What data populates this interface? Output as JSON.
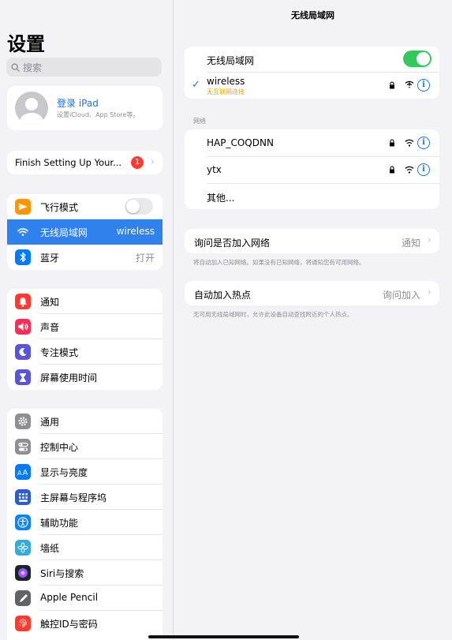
{
  "sidebar": {
    "title": "设置",
    "search_placeholder": "搜索",
    "profile": {
      "title": "登录 iPad",
      "subtitle": "设置iCloud、App Store等。"
    },
    "finish_setup": {
      "label": "Finish Setting Up Your...",
      "badge": "1"
    },
    "group1": [
      {
        "label": "飞行模式",
        "icon": "airplane-icon",
        "color": "#ff9500",
        "value": ""
      },
      {
        "label": "无线局域网",
        "icon": "wifi-icon",
        "color": "#2f82ee",
        "value": "wireless"
      },
      {
        "label": "蓝牙",
        "icon": "bluetooth-icon",
        "color": "#007aff",
        "value": "打开"
      }
    ],
    "group2": [
      {
        "label": "通知",
        "icon": "bell-icon",
        "color": "#ff3b30"
      },
      {
        "label": "声音",
        "icon": "speaker-icon",
        "color": "#ff2d55"
      },
      {
        "label": "专注模式",
        "icon": "moon-icon",
        "color": "#5856d6"
      },
      {
        "label": "屏幕使用时间",
        "icon": "hourglass-icon",
        "color": "#5856d6"
      }
    ],
    "group3": [
      {
        "label": "通用",
        "icon": "gear-icon",
        "color": "#8e8e93"
      },
      {
        "label": "控制中心",
        "icon": "switches-icon",
        "color": "#8e8e93"
      },
      {
        "label": "显示与亮度",
        "icon": "text-size-icon",
        "color": "#007aff"
      },
      {
        "label": "主屏幕与程序坞",
        "icon": "grid-icon",
        "color": "#2c5bd6"
      },
      {
        "label": "辅助功能",
        "icon": "accessibility-icon",
        "color": "#0a84ff"
      },
      {
        "label": "墙纸",
        "icon": "flower-icon",
        "color": "#36aadc"
      },
      {
        "label": "Siri与搜索",
        "icon": "siri-icon",
        "color": "#222222"
      },
      {
        "label": "Apple Pencil",
        "icon": "pencil-icon",
        "color": "#636366"
      },
      {
        "label": "触控ID与密码",
        "icon": "fingerprint-icon",
        "color": "#ff3b30"
      }
    ]
  },
  "detail": {
    "title": "无线局域网",
    "wifi_toggle_label": "无线局域网",
    "connected": {
      "name": "wireless",
      "status": "无互联网连接"
    },
    "networks_header": "网络",
    "networks": [
      {
        "name": "HAP_COQDNN"
      },
      {
        "name": "ytx"
      }
    ],
    "other": "其他...",
    "ask_join": {
      "label": "询问是否加入网络",
      "value": "通知",
      "footnote": "将自动加入已知网络。如果没有已知网络，将通知您有可用网络。"
    },
    "auto_hotspot": {
      "label": "自动加入热点",
      "value": "询问加入",
      "footnote": "无可用无线局域网时，允许此设备自动查找附近的个人热点。"
    }
  }
}
